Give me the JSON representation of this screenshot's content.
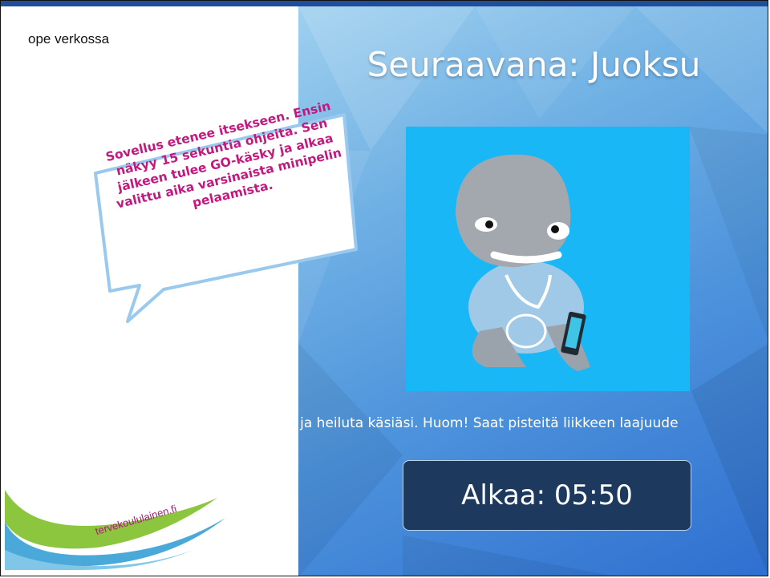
{
  "header": {
    "title": "ope verkossa"
  },
  "bubble": {
    "text": "Sovellus etenee itsekseen. Ensin näkyy 15 sekuntia ohjeita. Sen jälkeen tulee GO-käsky ja alkaa valittu aika varsinaista minipelin pelaamista."
  },
  "logo": {
    "text": "tervekoululainen.fi"
  },
  "app": {
    "title": "Seuraavana: Juoksu",
    "instruction": "i ja heiluta käsiäsi. Huom! Saat pisteitä liikkeen laajuude",
    "countdown": "Alkaa: 05:50"
  },
  "colors": {
    "accent_magenta": "#c3197f",
    "app_blue": "#2f6fd0",
    "countdown_bg": "#1d3a5e",
    "image_bg": "#19b7f5"
  }
}
